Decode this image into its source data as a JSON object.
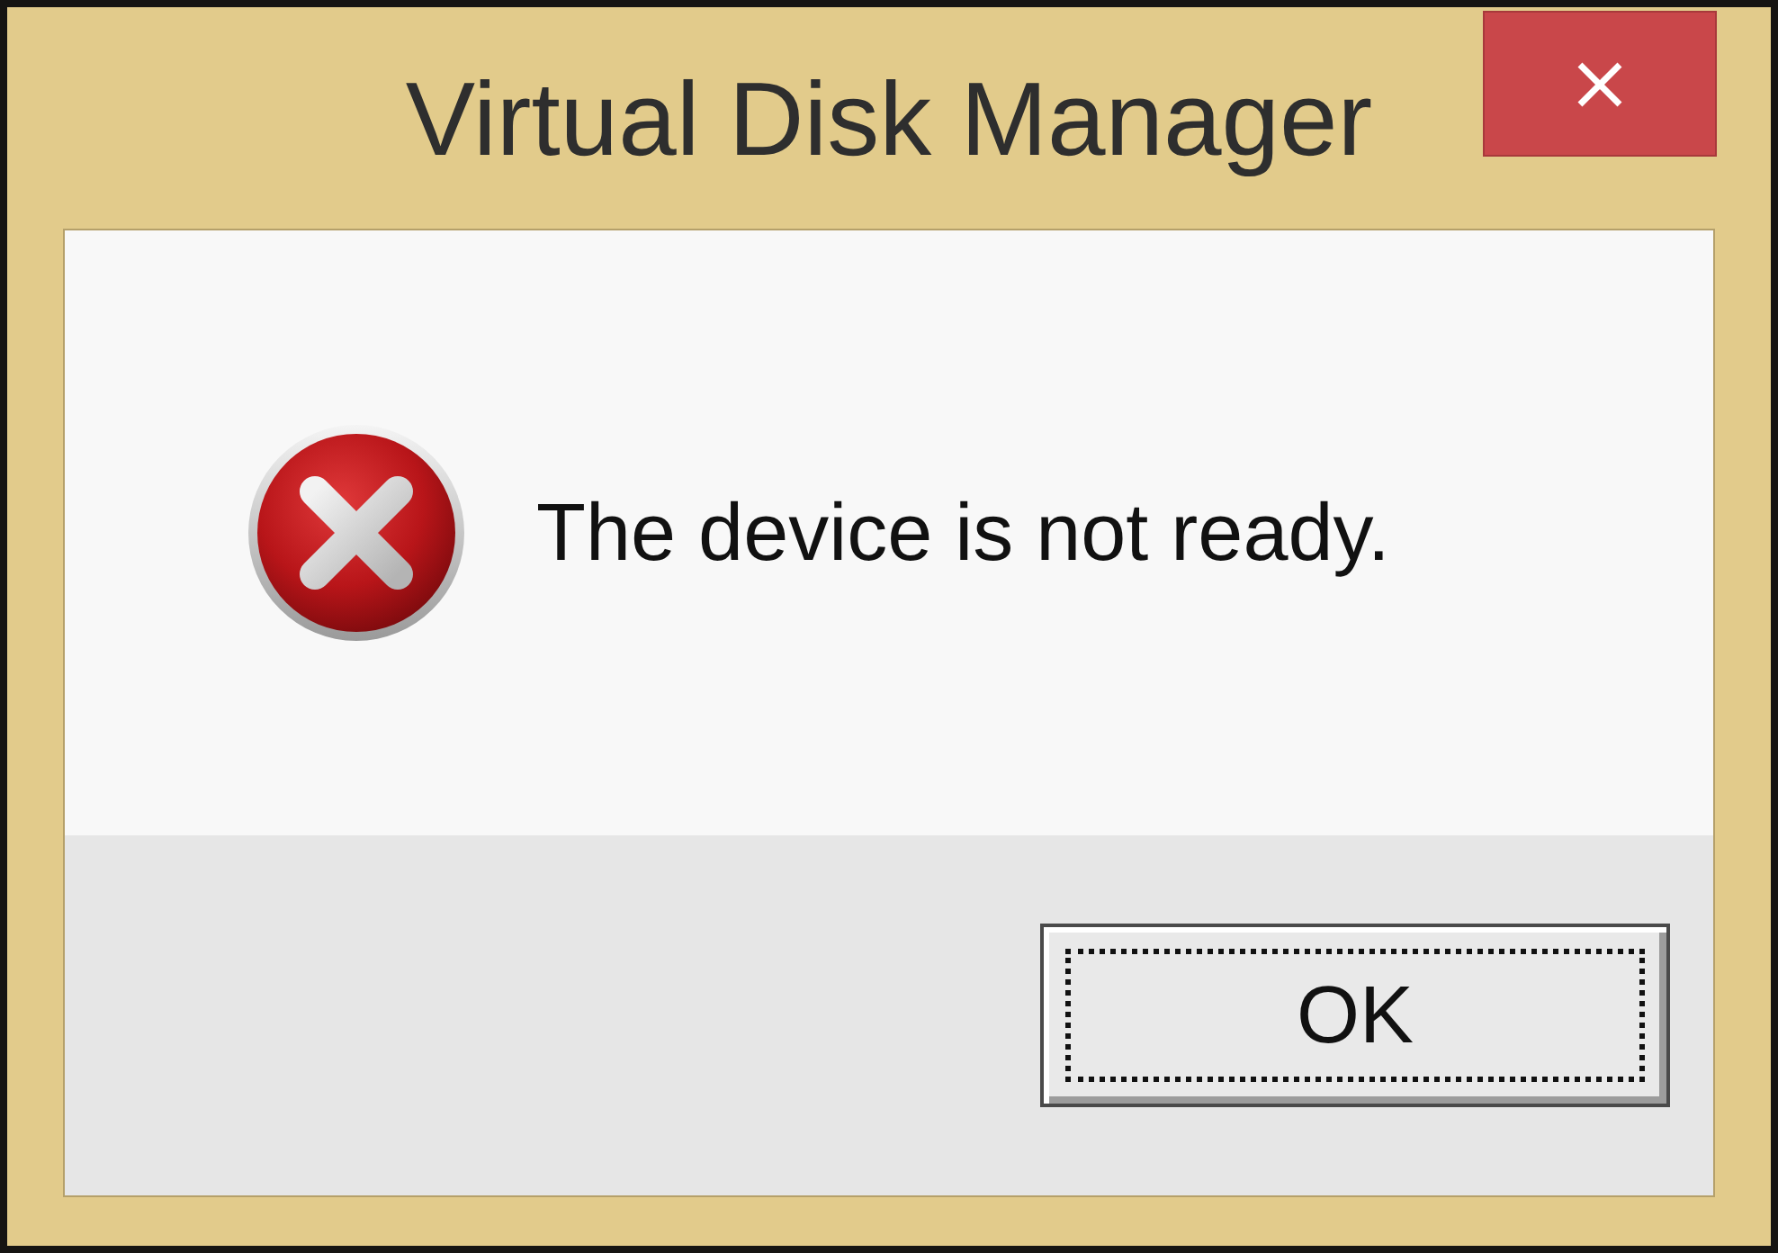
{
  "window": {
    "title": "Virtual Disk Manager"
  },
  "message": "The device is not ready.",
  "buttons": [
    {
      "label": "OK",
      "focused": true
    }
  ]
}
